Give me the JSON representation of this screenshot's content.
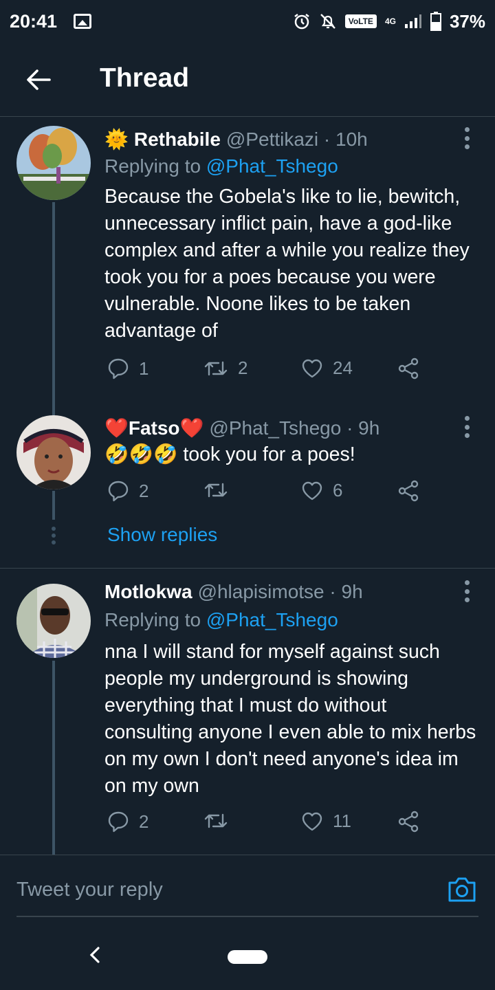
{
  "status_bar": {
    "time": "20:41",
    "volte": "VoLTE",
    "network": "4G",
    "battery": "37%"
  },
  "header": {
    "title": "Thread"
  },
  "tweets": [
    {
      "emoji_prefix": "🌞",
      "display_name": "Rethabile",
      "handle": "@Pettikazi · 10h",
      "replying_to_prefix": "Replying to ",
      "replying_to": "@Phat_Tshego",
      "text": "Because the Gobela's like to lie, bewitch, unnecessary inflict pain, have a god-like complex and after a while you realize they took you for a poes because you were vulnerable. Noone likes to be taken advantage of",
      "replies": "1",
      "retweets": "2",
      "likes": "24"
    },
    {
      "display_name": "❤️Fatso❤️",
      "handle": "@Phat_Tshego · 9h",
      "text": "🤣🤣🤣 took you for a poes!",
      "replies": "2",
      "retweets": "",
      "likes": "6"
    },
    {
      "display_name": "Motlokwa",
      "handle": "@hlapisimotse · 9h",
      "replying_to_prefix": "Replying to ",
      "replying_to": "@Phat_Tshego",
      "text": "nna I will stand for myself against such people my underground is showing everything that I must do without consulting anyone I even able to mix herbs on my own I don't need anyone's idea im on my own",
      "replies": "2",
      "retweets": "",
      "likes": "11"
    }
  ],
  "show_replies": "Show replies",
  "compose": {
    "placeholder": "Tweet your reply"
  },
  "colors": {
    "background": "#15202b",
    "accent": "#1da1f2",
    "secondary_text": "#8899a6",
    "divider": "#38444d"
  }
}
